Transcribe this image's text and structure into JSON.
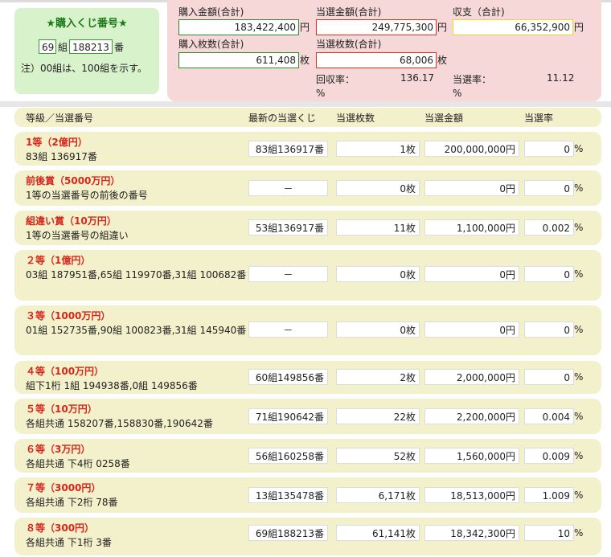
{
  "ticket": {
    "title": "★購入くじ番号★",
    "group": "69",
    "group_unit": "組",
    "number": "188213",
    "number_unit": "番",
    "note": "注）00組は、100組を示す。"
  },
  "summary": {
    "purchase_amount_label": "購入金額(合計)",
    "purchase_amount": "183,422,400",
    "win_amount_label": "当選金額(合計)",
    "win_amount": "249,775,300",
    "balance_label": "収支（合計)",
    "balance": "66,352,900",
    "purchase_count_label": "購入枚数(合計)",
    "purchase_count": "611,408",
    "win_count_label": "当選枚数(合計)",
    "win_count": "68,006",
    "recovery_label": "回収率：",
    "recovery_value": "136.17",
    "win_rate_label": "当選率：",
    "win_rate_value": "11.12",
    "yen": "円",
    "mai": "枚",
    "pct": "%"
  },
  "table_header": {
    "tier": "等級／当選番号",
    "latest": "最新の当選くじ",
    "count": "当選枚数",
    "amount": "当選金額",
    "rate": "当選率"
  },
  "rows": [
    {
      "tier": "1等（2億円）",
      "desc": "83組 136917番",
      "latest": "83組136917番",
      "count": "1",
      "amount": "200,000,000",
      "rate": "0"
    },
    {
      "tier": "前後賞（5000万円）",
      "desc": "1等の当選番号の前後の番号",
      "latest": "－",
      "count": "0",
      "amount": "0",
      "rate": "0"
    },
    {
      "tier": "組違い賞（10万円）",
      "desc": "1等の当選番号の組違い",
      "latest": "53組136917番",
      "count": "11",
      "amount": "1,100,000",
      "rate": "0.002"
    },
    {
      "tier": "２等（1億円）",
      "desc": "03組 187951番,65組 119970番,31組 100682番",
      "latest": "－",
      "count": "0",
      "amount": "0",
      "rate": "0"
    },
    {
      "tier": "３等（1000万円）",
      "desc": "01組 152735番,90組 100823番,31組 145940番",
      "latest": "－",
      "count": "0",
      "amount": "0",
      "rate": "0"
    },
    {
      "tier": "４等（100万円）",
      "desc": "組下1桁 1組 194938番,0組 149856番",
      "latest": "60組149856番",
      "count": "2",
      "amount": "2,000,000",
      "rate": "0"
    },
    {
      "tier": "５等（10万円）",
      "desc": "各組共通 158207番,158830番,190642番",
      "latest": "71組190642番",
      "count": "22",
      "amount": "2,200,000",
      "rate": "0.004"
    },
    {
      "tier": "６等（3万円）",
      "desc": "各組共通 下4桁 0258番",
      "latest": "56組160258番",
      "count": "52",
      "amount": "1,560,000",
      "rate": "0.009"
    },
    {
      "tier": "７等（3000円）",
      "desc": "各組共通 下2桁 78番",
      "latest": "13組135478番",
      "count": "6,171",
      "amount": "18,513,000",
      "rate": "1.009"
    },
    {
      "tier": "８等（300円）",
      "desc": "各組共通 下1桁 3番",
      "latest": "69組188213番",
      "count": "61,141",
      "amount": "18,342,300",
      "rate": "10"
    }
  ]
}
